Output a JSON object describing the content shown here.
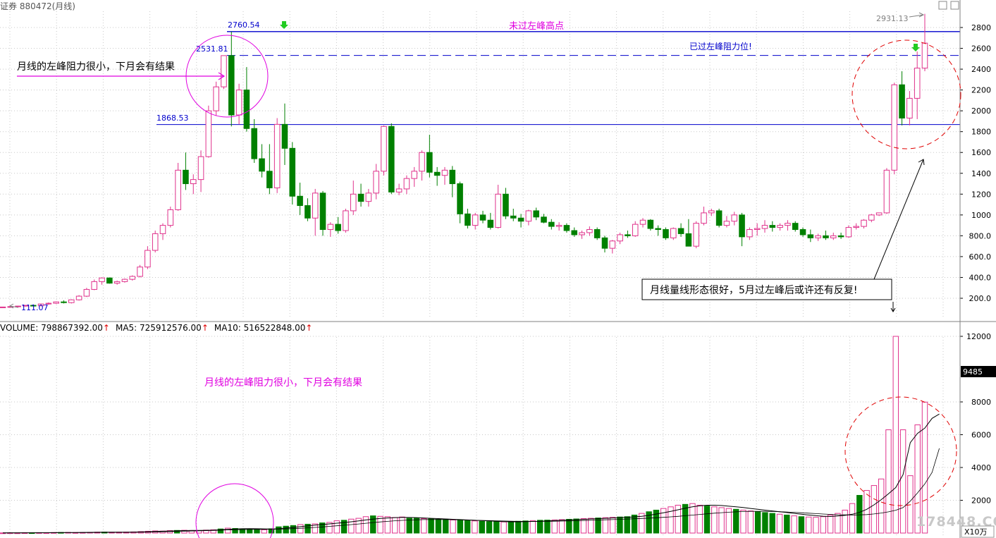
{
  "window": {
    "title": "证券 880472(月线)",
    "controls": [
      "▢",
      "▢"
    ]
  },
  "colors": {
    "up": "#e0328c",
    "down": "#008000",
    "level_line": "#0000cc",
    "annotation_magenta": "#e000e0",
    "annotation_red": "#e00000",
    "grid": "#c8c8c8",
    "axis_text": "#000000",
    "ma_line": "#000000"
  },
  "annotations": {
    "peak_high_label": "2760.54",
    "peak_close_label": "2531.81",
    "support_label": "1868.53",
    "low_label": "111.07",
    "recent_high_label": "2931.13",
    "top_line_text": "未过左峰高点",
    "dashed_line_text": "已过左峰阻力位!",
    "left_note": "月线的左峰阻力很小，下月会有结果",
    "right_note": "月线量线形态很好，5月过左峰后或许还有反复!",
    "volume_note": "月线的左峰阻力很小，下月会有结果",
    "watermark": "178448.COM"
  },
  "volume_header": {
    "volume": "VOLUME: 798867392.00",
    "ma5": "MA5: 725912576.00",
    "ma10": "MA10: 516522848.00"
  },
  "chart_data": [
    {
      "type": "candlestick",
      "title": "880472(月线)",
      "y_ticks": [
        "200.0",
        "400.0",
        "600.0",
        "800.0",
        "1000",
        "1200",
        "1400",
        "1600",
        "1800",
        "2000",
        "2200",
        "2400",
        "2600",
        "2800"
      ],
      "ylim": [
        0,
        2930
      ],
      "levels": [
        2760.54,
        2531.81,
        1868.53
      ],
      "candles": [
        {
          "o": 111,
          "h": 118,
          "l": 110,
          "c": 116
        },
        {
          "o": 116,
          "h": 122,
          "l": 112,
          "c": 120
        },
        {
          "o": 120,
          "h": 128,
          "l": 116,
          "c": 125
        },
        {
          "o": 125,
          "h": 135,
          "l": 120,
          "c": 132
        },
        {
          "o": 132,
          "h": 140,
          "l": 126,
          "c": 128
        },
        {
          "o": 128,
          "h": 150,
          "l": 124,
          "c": 145
        },
        {
          "o": 145,
          "h": 160,
          "l": 138,
          "c": 152
        },
        {
          "o": 152,
          "h": 170,
          "l": 145,
          "c": 165
        },
        {
          "o": 165,
          "h": 180,
          "l": 150,
          "c": 158
        },
        {
          "o": 158,
          "h": 190,
          "l": 150,
          "c": 185
        },
        {
          "o": 185,
          "h": 230,
          "l": 178,
          "c": 220
        },
        {
          "o": 220,
          "h": 300,
          "l": 212,
          "c": 285
        },
        {
          "o": 285,
          "h": 380,
          "l": 278,
          "c": 360
        },
        {
          "o": 360,
          "h": 400,
          "l": 330,
          "c": 395
        },
        {
          "o": 395,
          "h": 400,
          "l": 340,
          "c": 345
        },
        {
          "o": 345,
          "h": 370,
          "l": 330,
          "c": 360
        },
        {
          "o": 360,
          "h": 390,
          "l": 350,
          "c": 382
        },
        {
          "o": 382,
          "h": 420,
          "l": 370,
          "c": 410
        },
        {
          "o": 410,
          "h": 520,
          "l": 400,
          "c": 500
        },
        {
          "o": 500,
          "h": 700,
          "l": 480,
          "c": 660
        },
        {
          "o": 660,
          "h": 850,
          "l": 640,
          "c": 820
        },
        {
          "o": 820,
          "h": 920,
          "l": 760,
          "c": 900
        },
        {
          "o": 900,
          "h": 1080,
          "l": 880,
          "c": 1050
        },
        {
          "o": 1050,
          "h": 1500,
          "l": 1040,
          "c": 1430
        },
        {
          "o": 1430,
          "h": 1600,
          "l": 1240,
          "c": 1300
        },
        {
          "o": 1300,
          "h": 1390,
          "l": 1200,
          "c": 1340
        },
        {
          "o": 1340,
          "h": 1620,
          "l": 1220,
          "c": 1560
        },
        {
          "o": 1560,
          "h": 2050,
          "l": 1550,
          "c": 2000
        },
        {
          "o": 2000,
          "h": 2280,
          "l": 1950,
          "c": 2230
        },
        {
          "o": 2230,
          "h": 2531,
          "l": 2210,
          "c": 2530
        },
        {
          "o": 2530,
          "h": 2760,
          "l": 1850,
          "c": 1960
        },
        {
          "o": 1960,
          "h": 2260,
          "l": 1870,
          "c": 2200
        },
        {
          "o": 2200,
          "h": 2420,
          "l": 1800,
          "c": 1830
        },
        {
          "o": 1830,
          "h": 1920,
          "l": 1500,
          "c": 1540
        },
        {
          "o": 1540,
          "h": 1680,
          "l": 1360,
          "c": 1420
        },
        {
          "o": 1420,
          "h": 1680,
          "l": 1200,
          "c": 1260
        },
        {
          "o": 1260,
          "h": 1930,
          "l": 1210,
          "c": 1870
        },
        {
          "o": 1870,
          "h": 2070,
          "l": 1480,
          "c": 1640
        },
        {
          "o": 1640,
          "h": 1700,
          "l": 1100,
          "c": 1180
        },
        {
          "o": 1180,
          "h": 1310,
          "l": 1000,
          "c": 1090
        },
        {
          "o": 1090,
          "h": 1160,
          "l": 940,
          "c": 970
        },
        {
          "o": 970,
          "h": 1250,
          "l": 800,
          "c": 1210
        },
        {
          "o": 1210,
          "h": 1230,
          "l": 800,
          "c": 860
        },
        {
          "o": 860,
          "h": 930,
          "l": 790,
          "c": 910
        },
        {
          "o": 910,
          "h": 980,
          "l": 820,
          "c": 850
        },
        {
          "o": 850,
          "h": 1060,
          "l": 830,
          "c": 1040
        },
        {
          "o": 1040,
          "h": 1330,
          "l": 1000,
          "c": 1200
        },
        {
          "o": 1200,
          "h": 1300,
          "l": 1080,
          "c": 1130
        },
        {
          "o": 1130,
          "h": 1250,
          "l": 1080,
          "c": 1210
        },
        {
          "o": 1210,
          "h": 1490,
          "l": 1150,
          "c": 1420
        },
        {
          "o": 1420,
          "h": 1860,
          "l": 1380,
          "c": 1850
        },
        {
          "o": 1850,
          "h": 1880,
          "l": 1200,
          "c": 1220
        },
        {
          "o": 1220,
          "h": 1300,
          "l": 1190,
          "c": 1250
        },
        {
          "o": 1250,
          "h": 1380,
          "l": 1200,
          "c": 1350
        },
        {
          "o": 1350,
          "h": 1460,
          "l": 1270,
          "c": 1420
        },
        {
          "o": 1420,
          "h": 1620,
          "l": 1330,
          "c": 1600
        },
        {
          "o": 1600,
          "h": 1770,
          "l": 1360,
          "c": 1410
        },
        {
          "o": 1410,
          "h": 1460,
          "l": 1280,
          "c": 1380
        },
        {
          "o": 1380,
          "h": 1460,
          "l": 1290,
          "c": 1430
        },
        {
          "o": 1430,
          "h": 1470,
          "l": 1170,
          "c": 1300
        },
        {
          "o": 1300,
          "h": 1320,
          "l": 920,
          "c": 1010
        },
        {
          "o": 1010,
          "h": 1060,
          "l": 870,
          "c": 900
        },
        {
          "o": 900,
          "h": 1020,
          "l": 860,
          "c": 1000
        },
        {
          "o": 1000,
          "h": 1040,
          "l": 920,
          "c": 950
        },
        {
          "o": 950,
          "h": 1020,
          "l": 860,
          "c": 880
        },
        {
          "o": 880,
          "h": 1290,
          "l": 870,
          "c": 1200
        },
        {
          "o": 1200,
          "h": 1260,
          "l": 960,
          "c": 990
        },
        {
          "o": 990,
          "h": 1060,
          "l": 940,
          "c": 970
        },
        {
          "o": 970,
          "h": 1010,
          "l": 880,
          "c": 940
        },
        {
          "o": 940,
          "h": 1050,
          "l": 900,
          "c": 1040
        },
        {
          "o": 1040,
          "h": 1070,
          "l": 950,
          "c": 980
        },
        {
          "o": 980,
          "h": 1010,
          "l": 920,
          "c": 930
        },
        {
          "o": 930,
          "h": 960,
          "l": 860,
          "c": 890
        },
        {
          "o": 890,
          "h": 930,
          "l": 850,
          "c": 900
        },
        {
          "o": 900,
          "h": 920,
          "l": 830,
          "c": 850
        },
        {
          "o": 850,
          "h": 880,
          "l": 790,
          "c": 810
        },
        {
          "o": 810,
          "h": 850,
          "l": 770,
          "c": 830
        },
        {
          "o": 830,
          "h": 890,
          "l": 800,
          "c": 860
        },
        {
          "o": 860,
          "h": 880,
          "l": 760,
          "c": 780
        },
        {
          "o": 780,
          "h": 800,
          "l": 640,
          "c": 680
        },
        {
          "o": 680,
          "h": 760,
          "l": 630,
          "c": 750
        },
        {
          "o": 750,
          "h": 830,
          "l": 720,
          "c": 810
        },
        {
          "o": 810,
          "h": 850,
          "l": 780,
          "c": 800
        },
        {
          "o": 800,
          "h": 940,
          "l": 790,
          "c": 910
        },
        {
          "o": 910,
          "h": 970,
          "l": 880,
          "c": 950
        },
        {
          "o": 950,
          "h": 960,
          "l": 850,
          "c": 870
        },
        {
          "o": 870,
          "h": 900,
          "l": 800,
          "c": 860
        },
        {
          "o": 860,
          "h": 880,
          "l": 760,
          "c": 780
        },
        {
          "o": 780,
          "h": 880,
          "l": 760,
          "c": 870
        },
        {
          "o": 870,
          "h": 920,
          "l": 790,
          "c": 820
        },
        {
          "o": 820,
          "h": 960,
          "l": 700,
          "c": 700
        },
        {
          "o": 700,
          "h": 940,
          "l": 680,
          "c": 920
        },
        {
          "o": 920,
          "h": 1080,
          "l": 900,
          "c": 1020
        },
        {
          "o": 1020,
          "h": 1060,
          "l": 990,
          "c": 1040
        },
        {
          "o": 1040,
          "h": 1060,
          "l": 880,
          "c": 900
        },
        {
          "o": 900,
          "h": 990,
          "l": 880,
          "c": 940
        },
        {
          "o": 940,
          "h": 1030,
          "l": 900,
          "c": 1000
        },
        {
          "o": 1000,
          "h": 1020,
          "l": 700,
          "c": 790
        },
        {
          "o": 790,
          "h": 880,
          "l": 760,
          "c": 860
        },
        {
          "o": 860,
          "h": 920,
          "l": 800,
          "c": 870
        },
        {
          "o": 870,
          "h": 950,
          "l": 830,
          "c": 900
        },
        {
          "o": 900,
          "h": 940,
          "l": 840,
          "c": 880
        },
        {
          "o": 880,
          "h": 920,
          "l": 850,
          "c": 900
        },
        {
          "o": 900,
          "h": 950,
          "l": 850,
          "c": 920
        },
        {
          "o": 920,
          "h": 940,
          "l": 840,
          "c": 860
        },
        {
          "o": 860,
          "h": 880,
          "l": 790,
          "c": 810
        },
        {
          "o": 810,
          "h": 860,
          "l": 740,
          "c": 780
        },
        {
          "o": 780,
          "h": 820,
          "l": 750,
          "c": 800
        },
        {
          "o": 800,
          "h": 850,
          "l": 760,
          "c": 780
        },
        {
          "o": 780,
          "h": 830,
          "l": 760,
          "c": 800
        },
        {
          "o": 800,
          "h": 830,
          "l": 770,
          "c": 790
        },
        {
          "o": 790,
          "h": 900,
          "l": 780,
          "c": 880
        },
        {
          "o": 880,
          "h": 920,
          "l": 860,
          "c": 890
        },
        {
          "o": 890,
          "h": 960,
          "l": 870,
          "c": 950
        },
        {
          "o": 950,
          "h": 1010,
          "l": 930,
          "c": 1000
        },
        {
          "o": 1000,
          "h": 1020,
          "l": 990,
          "c": 1020
        },
        {
          "o": 1020,
          "h": 1450,
          "l": 1010,
          "c": 1430
        },
        {
          "o": 1430,
          "h": 2270,
          "l": 1390,
          "c": 2250
        },
        {
          "o": 2250,
          "h": 2380,
          "l": 1860,
          "c": 1930
        },
        {
          "o": 1930,
          "h": 2190,
          "l": 1860,
          "c": 2120
        },
        {
          "o": 2120,
          "h": 2570,
          "l": 1920,
          "c": 2410
        },
        {
          "o": 2410,
          "h": 2931,
          "l": 2380,
          "c": 2650
        }
      ]
    },
    {
      "type": "bar",
      "title": "VOLUME",
      "y_ticks": [
        "2000",
        "4000",
        "6000",
        "8000",
        "12000"
      ],
      "ylim": [
        0,
        12900
      ],
      "unit_label": "X10万",
      "current_value_label": "9485",
      "values": [
        10,
        15,
        12,
        20,
        18,
        25,
        22,
        30,
        35,
        40,
        30,
        35,
        45,
        55,
        60,
        50,
        55,
        60,
        70,
        90,
        110,
        130,
        120,
        150,
        160,
        170,
        140,
        150,
        180,
        200,
        250,
        300,
        280,
        260,
        240,
        230,
        200,
        260,
        380,
        420,
        460,
        520,
        540,
        560,
        620,
        650,
        750,
        780,
        850,
        900,
        1000,
        1050,
        1020,
        1000,
        950,
        980,
        900,
        920,
        880,
        860,
        840,
        820,
        800,
        780,
        760,
        740,
        720,
        700,
        690,
        680,
        700,
        720,
        740,
        760,
        780,
        790,
        800,
        820,
        840,
        860,
        880,
        900,
        920,
        940,
        960,
        980,
        1000,
        1100,
        1200,
        1300,
        1400,
        1500,
        1600,
        1700,
        1750,
        1800,
        1700,
        1650,
        1600,
        1550,
        1500,
        1450,
        1400,
        1350,
        1300,
        1250,
        1200,
        1150,
        1100,
        1050,
        1000,
        980,
        960,
        1000,
        1100,
        1200,
        1400,
        1800,
        2300,
        2600,
        2900,
        3300,
        6300,
        12000,
        6300,
        3500,
        6600,
        7988
      ],
      "ma5": [
        10,
        12,
        14,
        16,
        18,
        20,
        22,
        25,
        28,
        32,
        35,
        38,
        42,
        46,
        50,
        52,
        54,
        56,
        60,
        68,
        80,
        96,
        112,
        126,
        140,
        150,
        158,
        162,
        168,
        178,
        200,
        226,
        250,
        262,
        266,
        262,
        252,
        246,
        262,
        304,
        344,
        392,
        442,
        480,
        520,
        560,
        600,
        640,
        690,
        745,
        800,
        850,
        890,
        920,
        940,
        960,
        950,
        940,
        920,
        900,
        880,
        860,
        840,
        820,
        800,
        780,
        760,
        740,
        720,
        700,
        690,
        690,
        700,
        710,
        720,
        740,
        760,
        780,
        800,
        820,
        840,
        860,
        880,
        900,
        920,
        940,
        960,
        990,
        1020,
        1080,
        1160,
        1240,
        1320,
        1420,
        1520,
        1600,
        1660,
        1700,
        1700,
        1680,
        1640,
        1600,
        1560,
        1500,
        1450,
        1400,
        1350,
        1300,
        1250,
        1200,
        1150,
        1100,
        1060,
        1030,
        1010,
        1040,
        1080,
        1150,
        1260,
        1450,
        1720,
        2040,
        2400,
        2780,
        3560,
        5520,
        6080,
        6400,
        7000,
        7259
      ],
      "ma10": [
        10,
        11,
        12,
        13,
        14,
        15,
        17,
        19,
        21,
        24,
        26,
        29,
        32,
        35,
        38,
        40,
        42,
        45,
        48,
        52,
        58,
        66,
        76,
        88,
        100,
        112,
        124,
        136,
        148,
        160,
        176,
        192,
        206,
        216,
        222,
        226,
        228,
        232,
        240,
        254,
        270,
        292,
        318,
        344,
        374,
        408,
        442,
        478,
        516,
        556,
        598,
        640,
        680,
        716,
        748,
        776,
        796,
        810,
        820,
        826,
        830,
        826,
        818,
        808,
        796,
        784,
        772,
        760,
        748,
        736,
        724,
        716,
        712,
        710,
        712,
        716,
        722,
        730,
        740,
        752,
        766,
        780,
        794,
        808,
        822,
        838,
        854,
        872,
        890,
        910,
        932,
        958,
        988,
        1020,
        1056,
        1096,
        1136,
        1176,
        1212,
        1244,
        1272,
        1296,
        1314,
        1324,
        1328,
        1326,
        1318,
        1304,
        1286,
        1264,
        1240,
        1214,
        1188,
        1162,
        1138,
        1120,
        1110,
        1106,
        1110,
        1128,
        1166,
        1222,
        1296,
        1392,
        1552,
        1950,
        2450,
        3000,
        3700,
        5165
      ]
    }
  ]
}
